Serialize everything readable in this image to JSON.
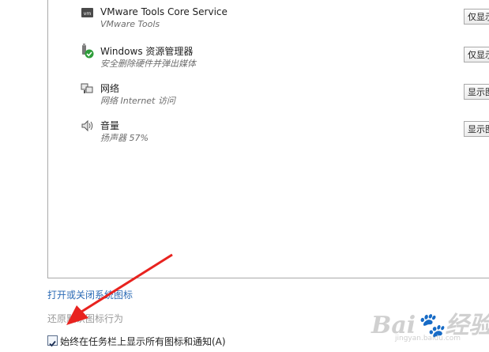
{
  "notification_icons": [
    {
      "name": "VMware Tools Core Service",
      "description": "VMware Tools",
      "behavior": "仅显示",
      "icon": "vmware-icon"
    },
    {
      "name": "Windows 资源管理器",
      "description": "安全删除硬件并弹出媒体",
      "behavior": "仅显示",
      "icon": "safely-remove-hardware-icon"
    },
    {
      "name": "网络",
      "description": "网络 Internet 访问",
      "behavior": "显示图",
      "icon": "network-icon"
    },
    {
      "name": "音量",
      "description": "扬声器 57%",
      "behavior": "显示图",
      "icon": "speaker-icon"
    }
  ],
  "links": {
    "system_icons": "打开或关闭系统图标",
    "restore_default": "还原默认图标行为"
  },
  "always_show": {
    "label": "始终在任务栏上显示所有图标和通知(A)",
    "checked": true
  },
  "watermark": {
    "logo": "Baidu 经验",
    "url": "jingyan.baidu.com"
  },
  "colors": {
    "link": "#2c6bb5",
    "annotation_arrow": "#e8231f"
  }
}
